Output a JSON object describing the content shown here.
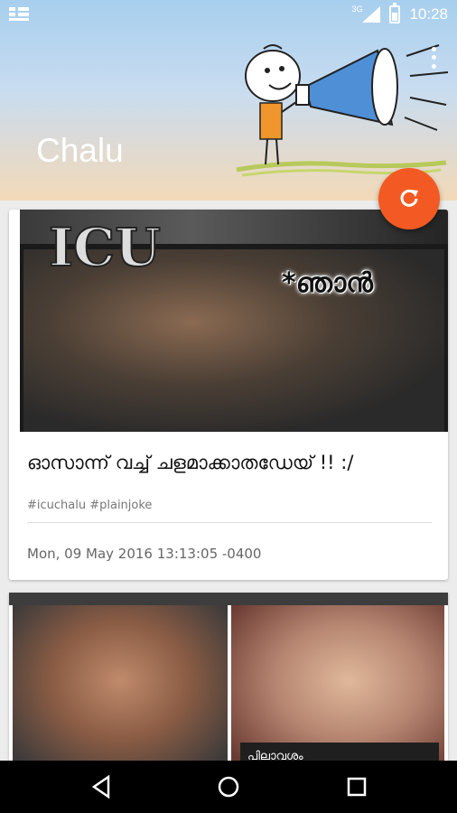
{
  "status": {
    "network": "3G",
    "time": "10:28"
  },
  "header": {
    "title": "Chalu"
  },
  "post": {
    "overlay_text": "*ഞാൻ",
    "caption": "ഓസാന്ന് വച്ച് ചളമാക്കാതഡേയ് !! :/",
    "tags": "#icuchalu #plainjoke",
    "date": "Mon, 09 May 2016 13:13:05 -0400"
  },
  "post2": {
    "label": "പിലാവശം"
  },
  "icons": {
    "refresh": "refresh-icon",
    "back": "back-icon",
    "home": "home-icon",
    "recents": "recents-icon",
    "overflow": "more-vert-icon"
  },
  "colors": {
    "fab": "#f35a23",
    "header_top": "#a7cfee",
    "header_bottom": "#f3d9b8"
  }
}
